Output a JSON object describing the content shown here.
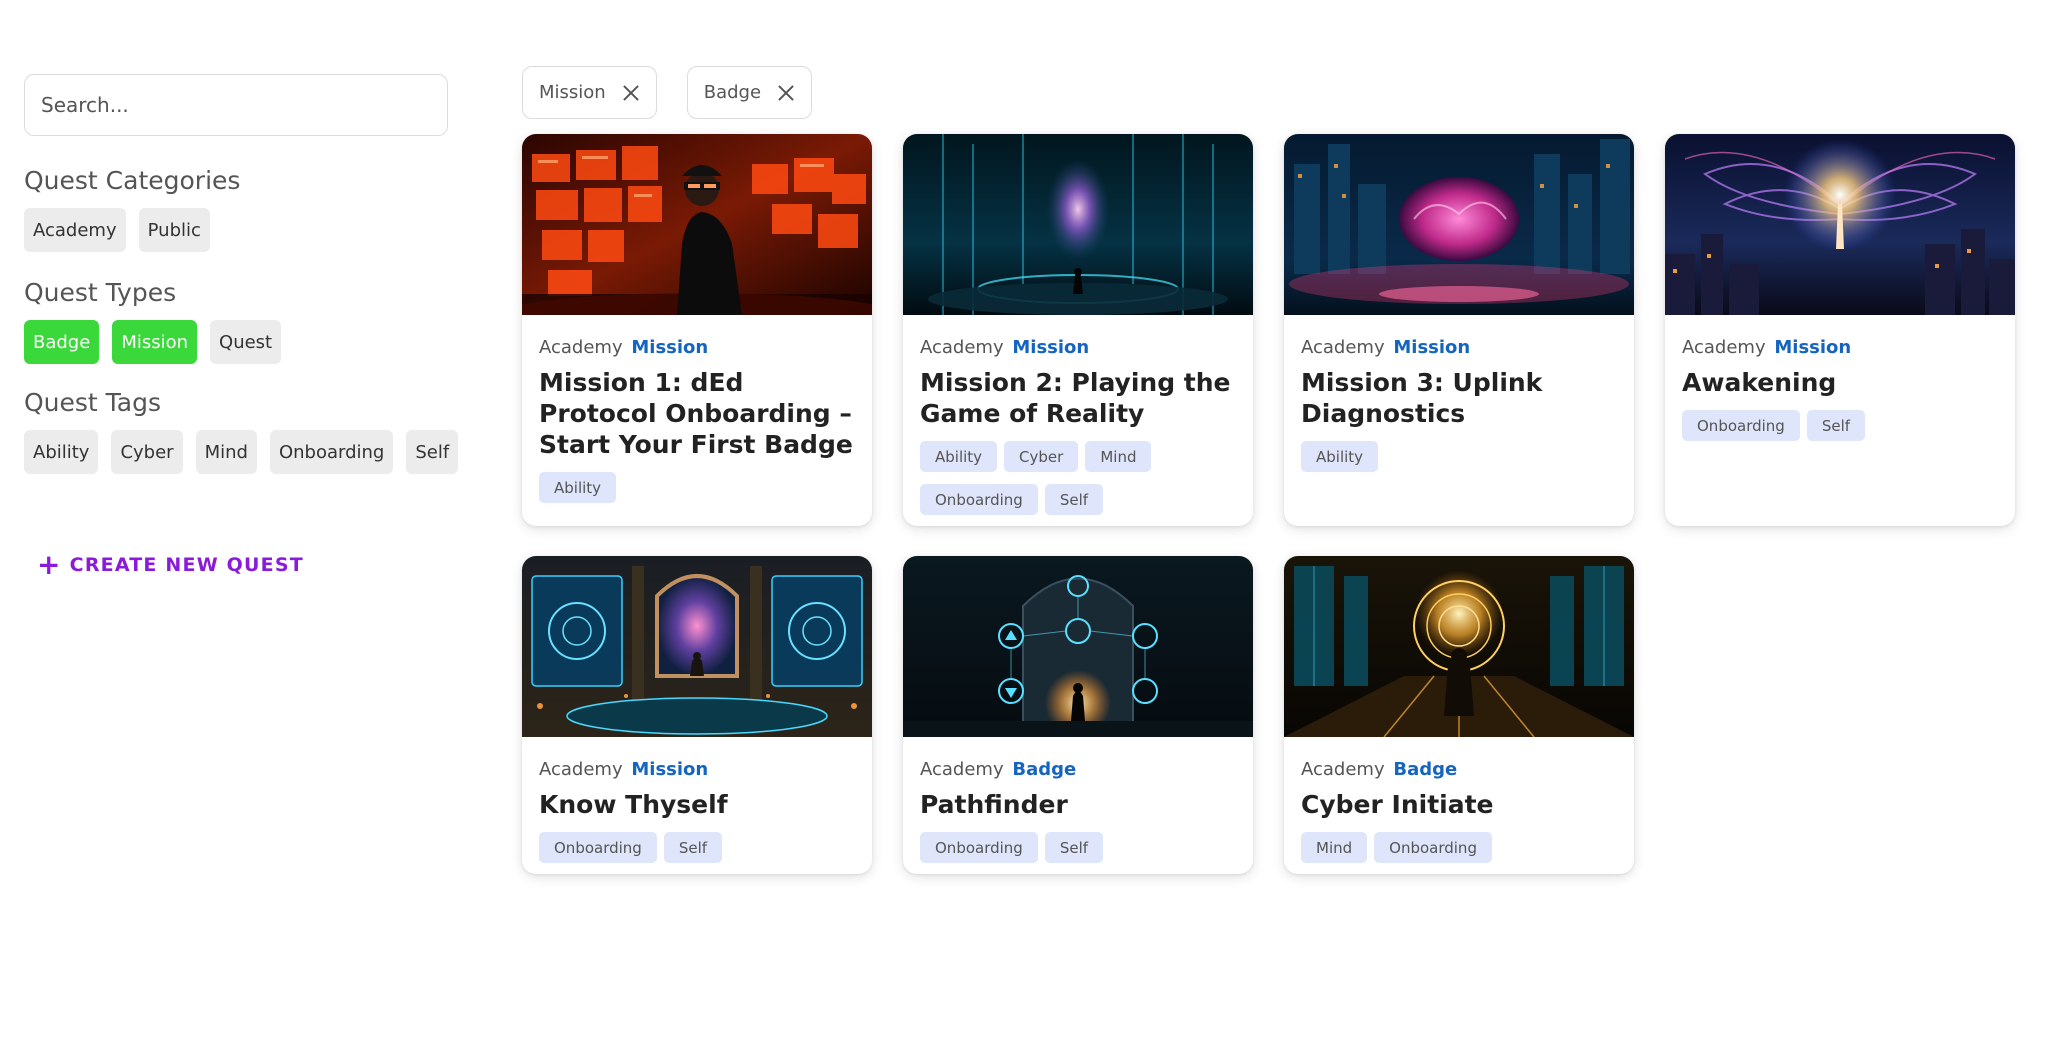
{
  "sidebar": {
    "search_placeholder": "Search...",
    "categories_title": "Quest Categories",
    "categories": [
      "Academy",
      "Public"
    ],
    "types_title": "Quest Types",
    "types": [
      {
        "label": "Badge",
        "active": true
      },
      {
        "label": "Mission",
        "active": true
      },
      {
        "label": "Quest",
        "active": false
      }
    ],
    "tags_title": "Quest Tags",
    "tags": [
      "Ability",
      "Cyber",
      "Mind",
      "Onboarding",
      "Self"
    ],
    "create_label": "CREATE NEW QUEST"
  },
  "filters": [
    {
      "label": "Mission"
    },
    {
      "label": "Badge"
    }
  ],
  "cards": [
    {
      "category": "Academy",
      "type": "Mission",
      "title": "Mission 1: dEd Protocol Onboarding – Start Your First Badge",
      "tags": [
        "Ability"
      ],
      "image": "cyber-figure-red-screens"
    },
    {
      "category": "Academy",
      "type": "Mission",
      "title": "Mission 2: Playing the Game of Reality",
      "tags": [
        "Ability",
        "Cyber",
        "Mind",
        "Onboarding",
        "Self"
      ],
      "image": "figure-cosmic-cylinder"
    },
    {
      "category": "Academy",
      "type": "Mission",
      "title": "Mission 3: Uplink Diagnostics",
      "tags": [
        "Ability"
      ],
      "image": "neon-brain-city"
    },
    {
      "category": "Academy",
      "type": "Mission",
      "title": "Awakening",
      "tags": [
        "Onboarding",
        "Self"
      ],
      "image": "glowing-figure-energy-wings"
    },
    {
      "category": "Academy",
      "type": "Mission",
      "title": "Know Thyself",
      "tags": [
        "Onboarding",
        "Self"
      ],
      "image": "temple-portal-screens"
    },
    {
      "category": "Academy",
      "type": "Badge",
      "title": "Pathfinder",
      "tags": [
        "Onboarding",
        "Self"
      ],
      "image": "figure-symbol-portal"
    },
    {
      "category": "Academy",
      "type": "Badge",
      "title": "Cyber Initiate",
      "tags": [
        "Mind",
        "Onboarding"
      ],
      "image": "robed-figure-golden-hall"
    }
  ]
}
